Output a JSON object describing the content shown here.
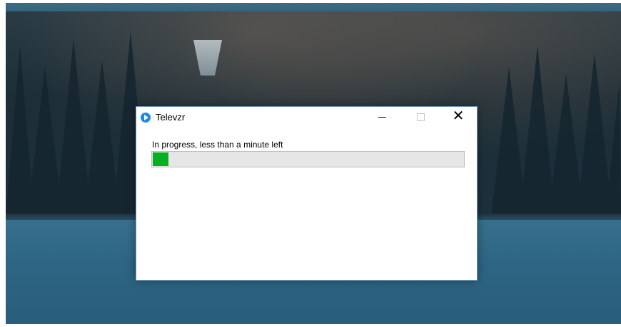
{
  "window": {
    "title": "Televzr",
    "icon": "televzr-app-icon",
    "controls": {
      "minimize_icon": "minimize-icon",
      "maximize_icon": "maximize-icon",
      "close_glyph": "✕"
    }
  },
  "progress": {
    "status_text": "In progress, less than a minute left",
    "percent": 5,
    "bar_color": "#06b025"
  }
}
